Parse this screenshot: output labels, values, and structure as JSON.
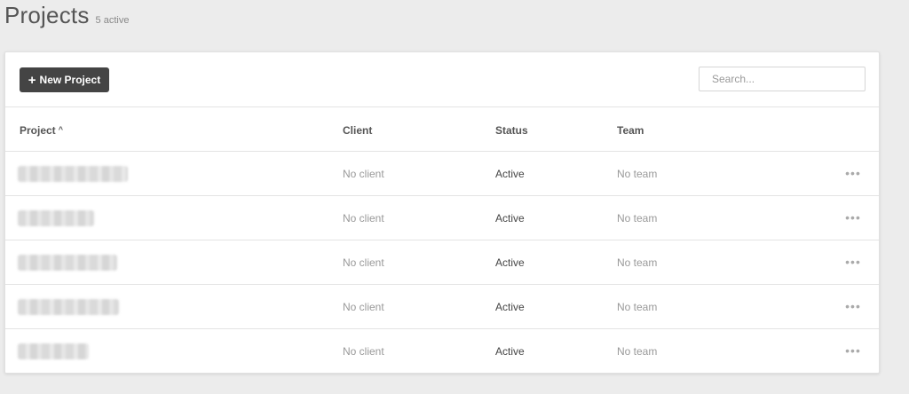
{
  "header": {
    "title": "Projects",
    "active_count": "5 active"
  },
  "toolbar": {
    "new_project_label": "New Project",
    "search_placeholder": "Search..."
  },
  "table": {
    "columns": [
      "Project",
      "Client",
      "Status",
      "Team"
    ],
    "rows": [
      {
        "project": "",
        "client": "No client",
        "status": "Active",
        "team": "No team"
      },
      {
        "project": "",
        "client": "No client",
        "status": "Active",
        "team": "No team"
      },
      {
        "project": "",
        "client": "No client",
        "status": "Active",
        "team": "No team"
      },
      {
        "project": "",
        "client": "No client",
        "status": "Active",
        "team": "No team"
      },
      {
        "project": "",
        "client": "No client",
        "status": "Active",
        "team": "No team"
      }
    ]
  },
  "colors": {
    "background": "#ececec",
    "button": "#444444",
    "card": "#ffffff"
  },
  "icons": {
    "new_project": "plus-icon",
    "sort": "sort-ascending-icon",
    "row_menu": "more-horizontal-icon"
  }
}
